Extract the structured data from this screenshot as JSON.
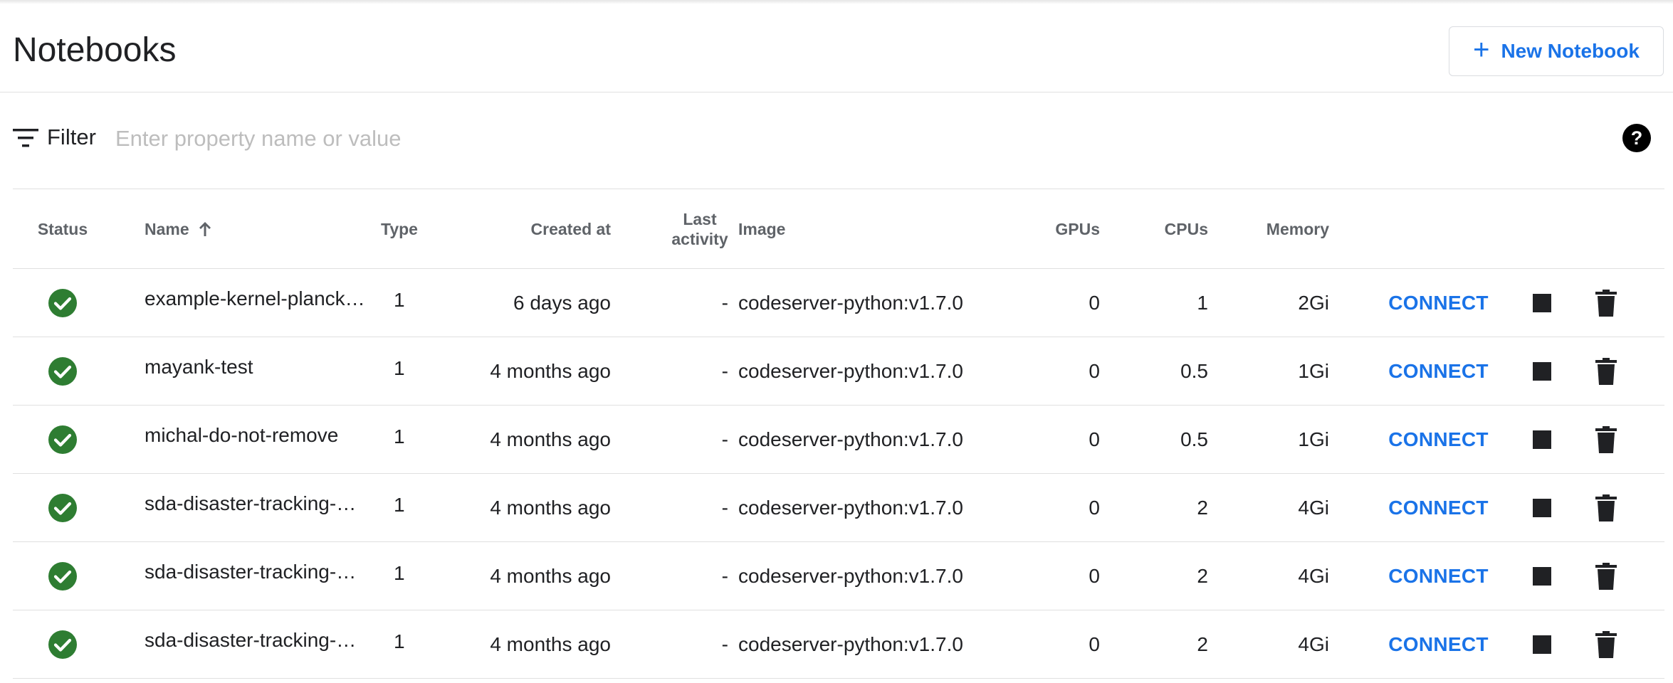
{
  "header": {
    "title": "Notebooks",
    "new_button_label": "New Notebook"
  },
  "filter": {
    "label": "Filter",
    "placeholder": "Enter property name or value"
  },
  "colors": {
    "accent": "#1a73e8",
    "status_ok": "#2e7d32"
  },
  "table": {
    "columns": {
      "status": "Status",
      "name": "Name",
      "type": "Type",
      "created_at": "Created at",
      "last_activity_1": "Last",
      "last_activity_2": "activity",
      "image": "Image",
      "gpus": "GPUs",
      "cpus": "CPUs",
      "memory": "Memory"
    },
    "sort": {
      "column": "name",
      "direction": "ascending"
    },
    "rows": [
      {
        "status": "ready",
        "name": "example-kernel-planck…",
        "type": "1",
        "created_at": "6 days ago",
        "last_activity": "-",
        "image": "codeserver-python:v1.7.0",
        "gpus": "0",
        "cpus": "1",
        "memory": "2Gi",
        "connect": "CONNECT"
      },
      {
        "status": "ready",
        "name": "mayank-test",
        "type": "1",
        "created_at": "4 months ago",
        "last_activity": "-",
        "image": "codeserver-python:v1.7.0",
        "gpus": "0",
        "cpus": "0.5",
        "memory": "1Gi",
        "connect": "CONNECT"
      },
      {
        "status": "ready",
        "name": "michal-do-not-remove",
        "type": "1",
        "created_at": "4 months ago",
        "last_activity": "-",
        "image": "codeserver-python:v1.7.0",
        "gpus": "0",
        "cpus": "0.5",
        "memory": "1Gi",
        "connect": "CONNECT"
      },
      {
        "status": "ready",
        "name": "sda-disaster-tracking-…",
        "type": "1",
        "created_at": "4 months ago",
        "last_activity": "-",
        "image": "codeserver-python:v1.7.0",
        "gpus": "0",
        "cpus": "2",
        "memory": "4Gi",
        "connect": "CONNECT"
      },
      {
        "status": "ready",
        "name": "sda-disaster-tracking-…",
        "type": "1",
        "created_at": "4 months ago",
        "last_activity": "-",
        "image": "codeserver-python:v1.7.0",
        "gpus": "0",
        "cpus": "2",
        "memory": "4Gi",
        "connect": "CONNECT"
      },
      {
        "status": "ready",
        "name": "sda-disaster-tracking-…",
        "type": "1",
        "created_at": "4 months ago",
        "last_activity": "-",
        "image": "codeserver-python:v1.7.0",
        "gpus": "0",
        "cpus": "2",
        "memory": "4Gi",
        "connect": "CONNECT"
      }
    ]
  }
}
